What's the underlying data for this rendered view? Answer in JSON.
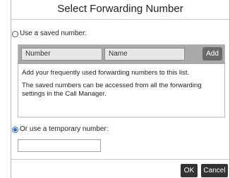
{
  "dialog": {
    "title": "Select Forwarding Number",
    "saved_option_label": "Use a saved number:",
    "saved_option_checked": false,
    "temp_option_label": "Or use a temporary number:",
    "temp_option_checked": true,
    "temp_number_value": "",
    "ok_label": "OK",
    "cancel_label": "Cancel"
  },
  "saved_numbers": {
    "columns": [
      "Number",
      "Name"
    ],
    "add_label": "Add",
    "messages": [
      "Add your frequently used forwarding numbers to this list.",
      "The saved numbers can be accessed from all the forwarding settings in the Call Manager."
    ]
  },
  "colors": {
    "header_bar": "#a9a9a9",
    "add_button": "#6a6a6a",
    "action_buttons": "#333333",
    "radio_selected": "#2a6fc9"
  }
}
